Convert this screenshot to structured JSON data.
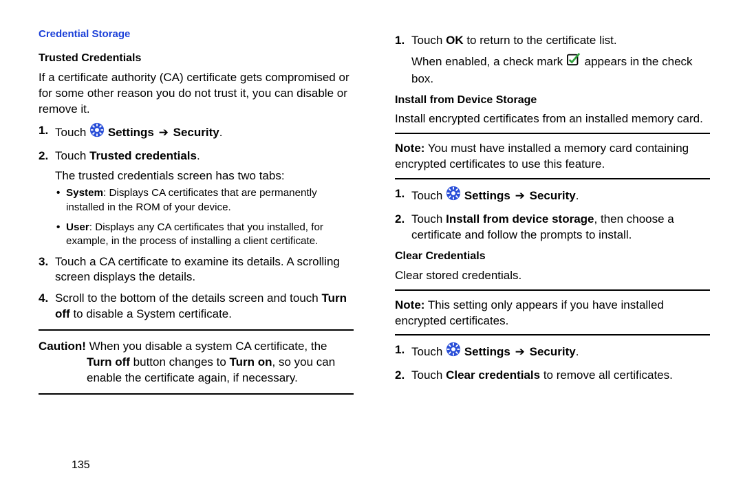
{
  "page": {
    "num": "135"
  },
  "left": {
    "sectionTitle": "Credential Storage",
    "sub1": "Trusted Credentials",
    "intro": "If a certificate authority (CA) certificate gets compromised or for some other reason you do not trust it, you can disable or remove it.",
    "step1_a": "Touch ",
    "step1_b1": "Settings",
    "step1_arrow": "➔",
    "step1_b2": "Security",
    "step1_c": ".",
    "step2_a": "Touch ",
    "step2_b": "Trusted credentials",
    "step2_c": ".",
    "step2_tail": "The trusted credentials screen has two tabs:",
    "bullet_sys_a": "System",
    "bullet_sys_b": ": Displays CA certificates that are permanently installed in the ROM of your device.",
    "bullet_usr_a": "User",
    "bullet_usr_b": ": Displays any CA certificates that you installed, for example, in the process of installing a client certificate.",
    "step3": "Touch a CA certificate to examine its details. A scrolling screen displays the details.",
    "step4_a": "Scroll to the bottom of the details screen and touch ",
    "step4_b": "Turn off",
    "step4_c": " to disable a System certificate.",
    "caution_lbl": "Caution!",
    "caution_a": " When you disable a system CA certificate, the ",
    "caution_b": "Turn off",
    "caution_c": " button changes to ",
    "caution_d": "Turn on",
    "caution_e": ", so you can enable the certificate again, if necessary."
  },
  "right": {
    "step5_a": "Touch ",
    "step5_b": "OK",
    "step5_c": " to return to the certificate list.",
    "step5_tail_a": "When enabled, a check mark ",
    "step5_tail_b": " appears in the check box.",
    "sub2": "Install from Device Storage",
    "install_intro": "Install encrypted certificates from an installed memory card.",
    "note1_lbl": "Note:",
    "note1_a": " You must have installed a memory card containing encrypted certificates to use this feature.",
    "istep1_a": "Touch ",
    "istep1_b1": "Settings",
    "istep1_arrow": "➔",
    "istep1_b2": "Security",
    "istep1_c": ".",
    "istep2_a": "Touch ",
    "istep2_b": "Install from device storage",
    "istep2_c": ", then choose a certificate and follow the prompts to install.",
    "sub3": "Clear Credentials",
    "clear_intro": "Clear stored credentials.",
    "note2_lbl": "Note:",
    "note2_a": " This setting only appears if you have installed encrypted certificates.",
    "cstep1_a": "Touch ",
    "cstep1_b1": "Settings",
    "cstep1_arrow": "➔",
    "cstep1_b2": "Security",
    "cstep1_c": ".",
    "cstep2_a": "Touch ",
    "cstep2_b": "Clear credentials",
    "cstep2_c": " to remove all certificates."
  },
  "icons": {
    "settings": "settings",
    "check": "check"
  }
}
